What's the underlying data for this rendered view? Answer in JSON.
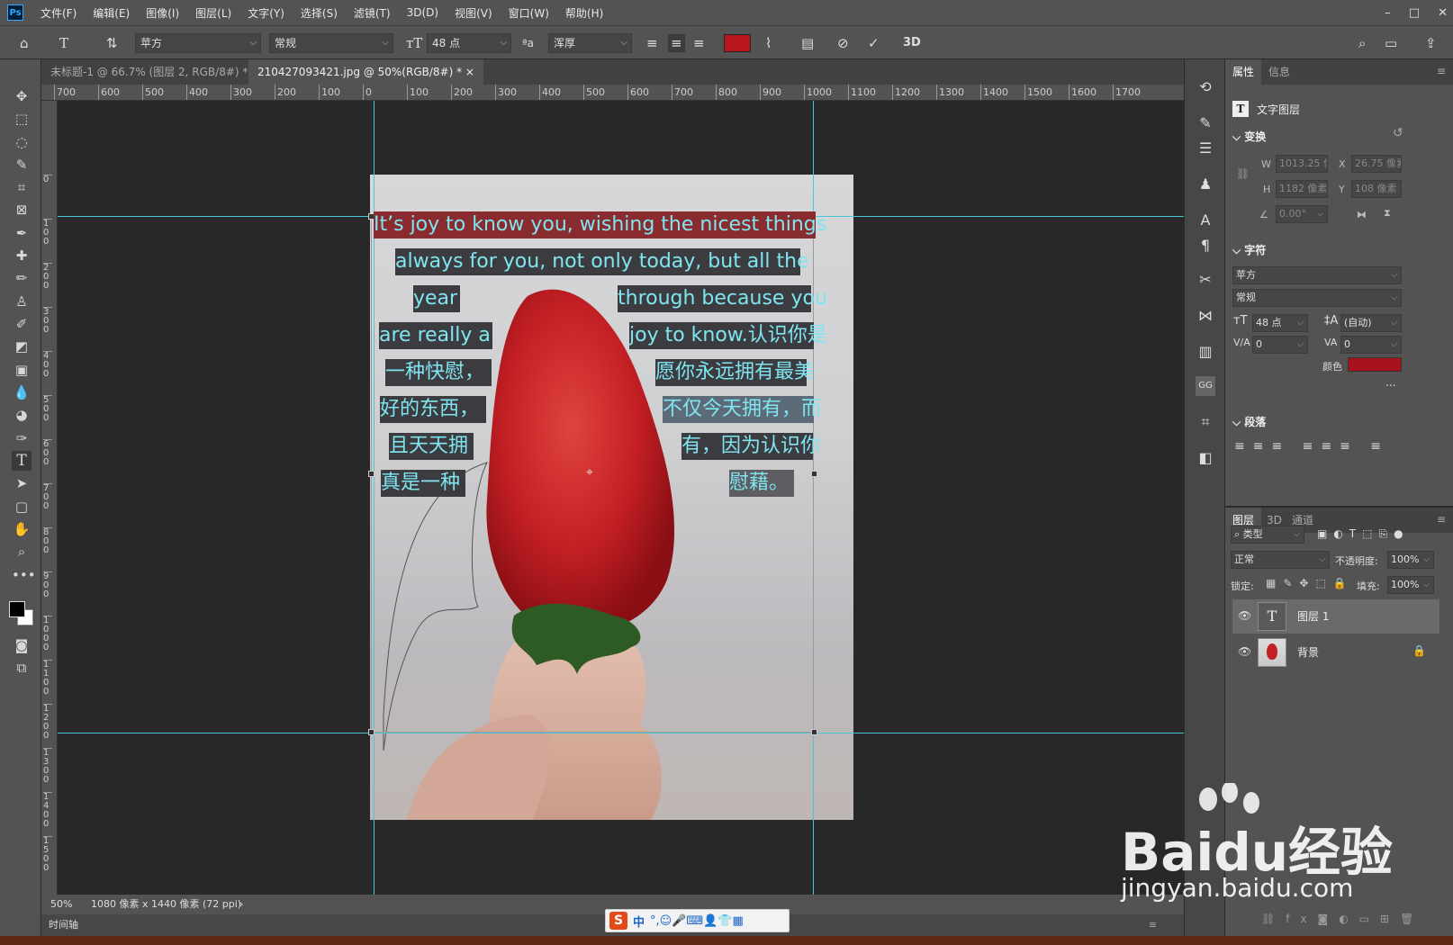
{
  "app": {
    "logo": "Ps"
  },
  "menubar": {
    "items": [
      "文件(F)",
      "编辑(E)",
      "图像(I)",
      "图层(L)",
      "文字(Y)",
      "选择(S)",
      "滤镜(T)",
      "3D(D)",
      "视图(V)",
      "窗口(W)",
      "帮助(H)"
    ],
    "min": "–",
    "max": "□",
    "close": "✕"
  },
  "options": {
    "font_family": "苹方",
    "font_style": "常规",
    "font_size": "48 点",
    "antialias": "浑厚",
    "aa_label": "ªa",
    "label_3d": "3D",
    "text_color": "#b8161f"
  },
  "tabs": [
    {
      "label": "未标题-1 @ 66.7% (图层 2, RGB/8#) *",
      "close": "×"
    },
    {
      "label": "210427093421.jpg @ 50%(RGB/8#) *",
      "close": "×"
    }
  ],
  "ruler": {
    "h_labels": [
      "700",
      "600",
      "500",
      "400",
      "300",
      "200",
      "100",
      "0",
      "100",
      "200",
      "300",
      "400",
      "500",
      "600",
      "700",
      "800",
      "900",
      "1000",
      "1100",
      "1200",
      "1300",
      "1400",
      "1500",
      "1600",
      "1700"
    ],
    "v_labels": [
      "0",
      "100",
      "200",
      "300",
      "400",
      "500",
      "600",
      "700",
      "800",
      "900",
      "1000",
      "1100",
      "1200",
      "1300",
      "1400",
      "1500"
    ]
  },
  "canvas_text": {
    "lines_left": [
      "It’s joy to know you, wishing the nicest things",
      "always for you, not only today, but all the",
      "year",
      "are really a",
      "一种快慰，",
      "好的东西，",
      "且天天拥",
      "真是一种"
    ],
    "lines_right": [
      "through because you",
      "joy to know.认识你是",
      "愿你永远拥有最美",
      "不仅今天拥有，而",
      "有，因为认识你",
      "慰藉。"
    ]
  },
  "statusbar": {
    "zoom": "50%",
    "doc_info": "1080 像素 x 1440 像素 (72 ppi)",
    "arrow": "›"
  },
  "timeline": {
    "label": "时间轴"
  },
  "ime": {
    "logo": "S",
    "lang": "中",
    "glyphs": "°,☺🎤⌨👤👕▦"
  },
  "properties": {
    "tab_props": "属性",
    "tab_info": "信息",
    "layer_type": "文字图层",
    "transform": {
      "title": "变换",
      "w_label": "W",
      "w": "1013.25 像",
      "x_label": "X",
      "x": "26.75 像素",
      "h_label": "H",
      "h": "1182 像素",
      "y_label": "Y",
      "y": "108 像素",
      "angle": "0.00°"
    },
    "character": {
      "title": "字符",
      "family": "苹方",
      "style": "常规",
      "size": "48 点",
      "leading": "(自动)",
      "kerning": "0",
      "tracking": "0",
      "color_label": "颜色",
      "color": "#a8121c",
      "more": "..."
    },
    "paragraph": {
      "title": "段落"
    }
  },
  "layers": {
    "tab_layers": "图层",
    "tab_3d": "3D",
    "tab_channels": "通道",
    "filter": "类型",
    "blend": "正常",
    "opacity_label": "不透明度:",
    "opacity": "100%",
    "lock_label": "锁定:",
    "fill_label": "填充:",
    "fill": "100%",
    "items": [
      {
        "name": "图层 1",
        "thumb": "T"
      },
      {
        "name": "背景"
      }
    ]
  },
  "watermark": {
    "brand": "Baidu经验",
    "url": "jingyan.baidu.com"
  }
}
